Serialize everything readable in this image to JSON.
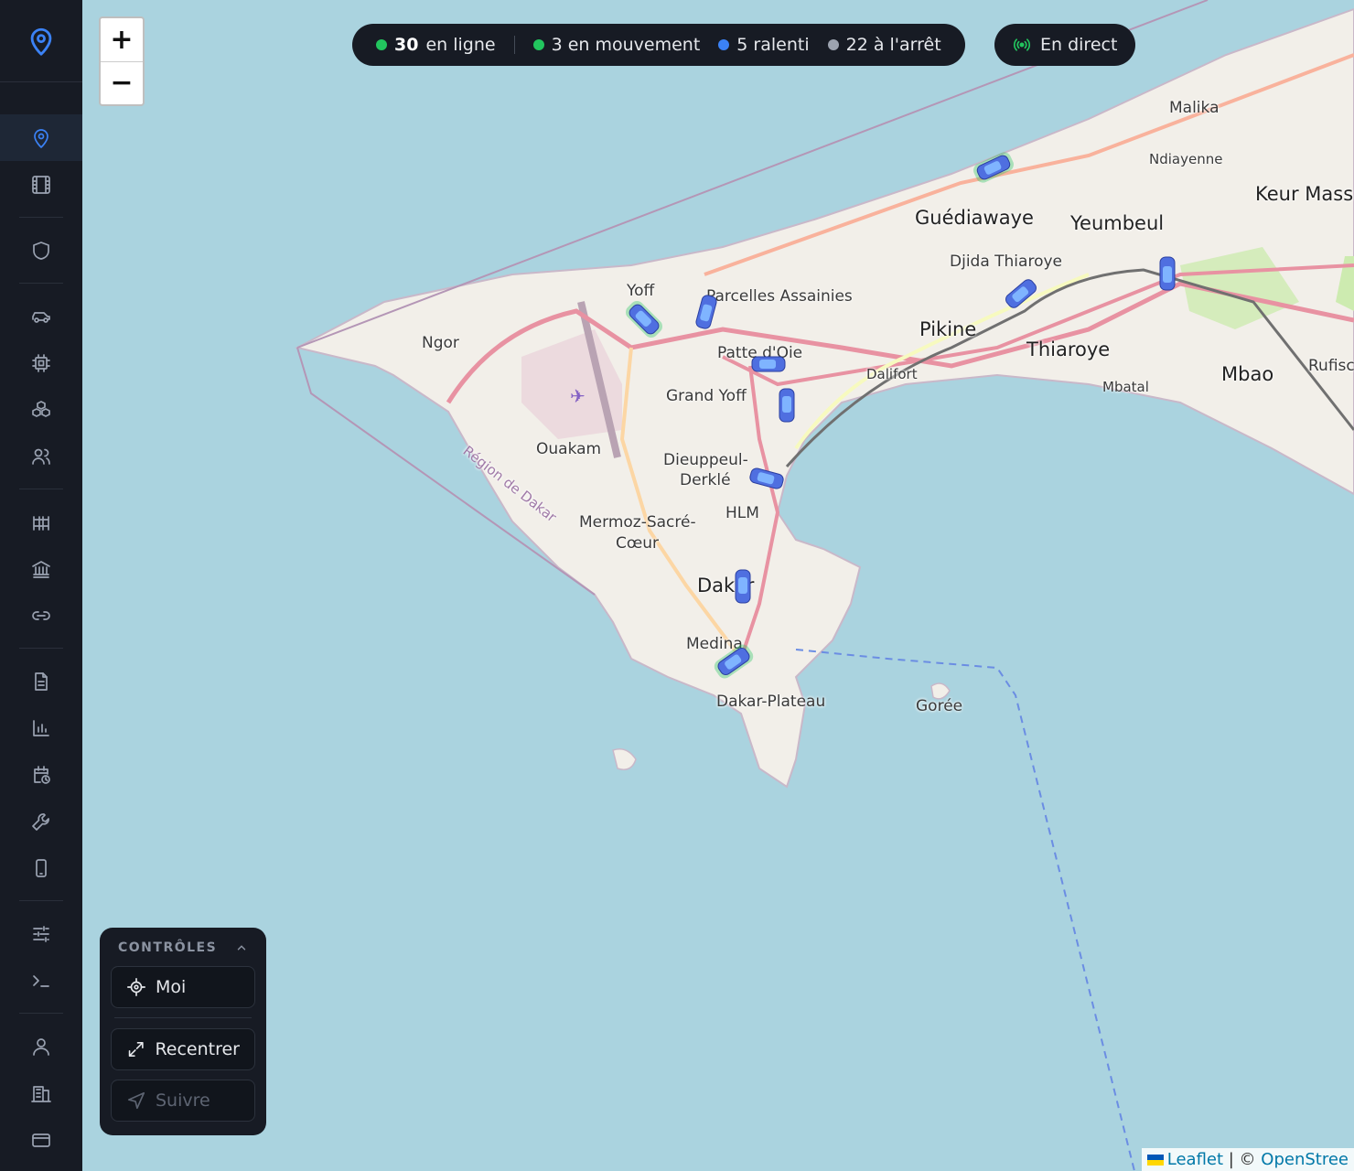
{
  "status": {
    "online_count": "30",
    "online_label": "en ligne",
    "moving": "3 en mouvement",
    "slow": "5 ralenti",
    "stopped": "22 à l'arrêt",
    "colors": {
      "moving": "#22c55e",
      "slow": "#3b82f6",
      "stopped": "#9ca3af",
      "online": "#22c55e"
    }
  },
  "live": {
    "label": "En direct"
  },
  "zoom": {
    "in": "+",
    "out": "−"
  },
  "controls": {
    "title": "CONTRÔLES",
    "me": "Moi",
    "recenter": "Recentrer",
    "follow": "Suivre"
  },
  "map": {
    "places": [
      "Malika",
      "Ndiayenne",
      "Keur Mass",
      "Guédiawaye",
      "Yeumbeul",
      "Djida Thiaroye",
      "Yoff",
      "Parcelles Assainies",
      "Ngor",
      "Pikine",
      "Thiaroye",
      "Patte d'Oie",
      "Dalifort",
      "Mbatal",
      "Mbao",
      "Rufisc",
      "Grand Yoff",
      "Ouakam",
      "Dieuppeul-",
      "Derklé",
      "Région de Dakar",
      "HLM",
      "Mermoz-Sacré-",
      "Cœur",
      "Dakar",
      "Medina",
      "Dakar-Plateau",
      "Gorée"
    ],
    "vehicles": [
      {
        "status": "moving"
      },
      {
        "status": "stopped"
      },
      {
        "status": "moving"
      },
      {
        "status": "stopped"
      },
      {
        "status": "stopped"
      },
      {
        "status": "stopped"
      },
      {
        "status": "stopped"
      },
      {
        "status": "stopped"
      },
      {
        "status": "moving"
      },
      {
        "status": "stopped"
      }
    ]
  },
  "attribution": {
    "leaflet": "Leaflet",
    "sep": " | © ",
    "osm": "OpenStree"
  },
  "sidebar_icons": [
    "location-pin-icon",
    "film-icon",
    "shield-icon",
    "car-icon",
    "chip-icon",
    "cubes-icon",
    "users-icon",
    "barrier-icon",
    "bank-icon",
    "link-icon",
    "document-icon",
    "bar-chart-icon",
    "calendar-clock-icon",
    "wrench-icon",
    "tablet-icon",
    "sliders-icon",
    "terminal-icon",
    "user-icon",
    "building-icon",
    "credit-card-icon"
  ]
}
